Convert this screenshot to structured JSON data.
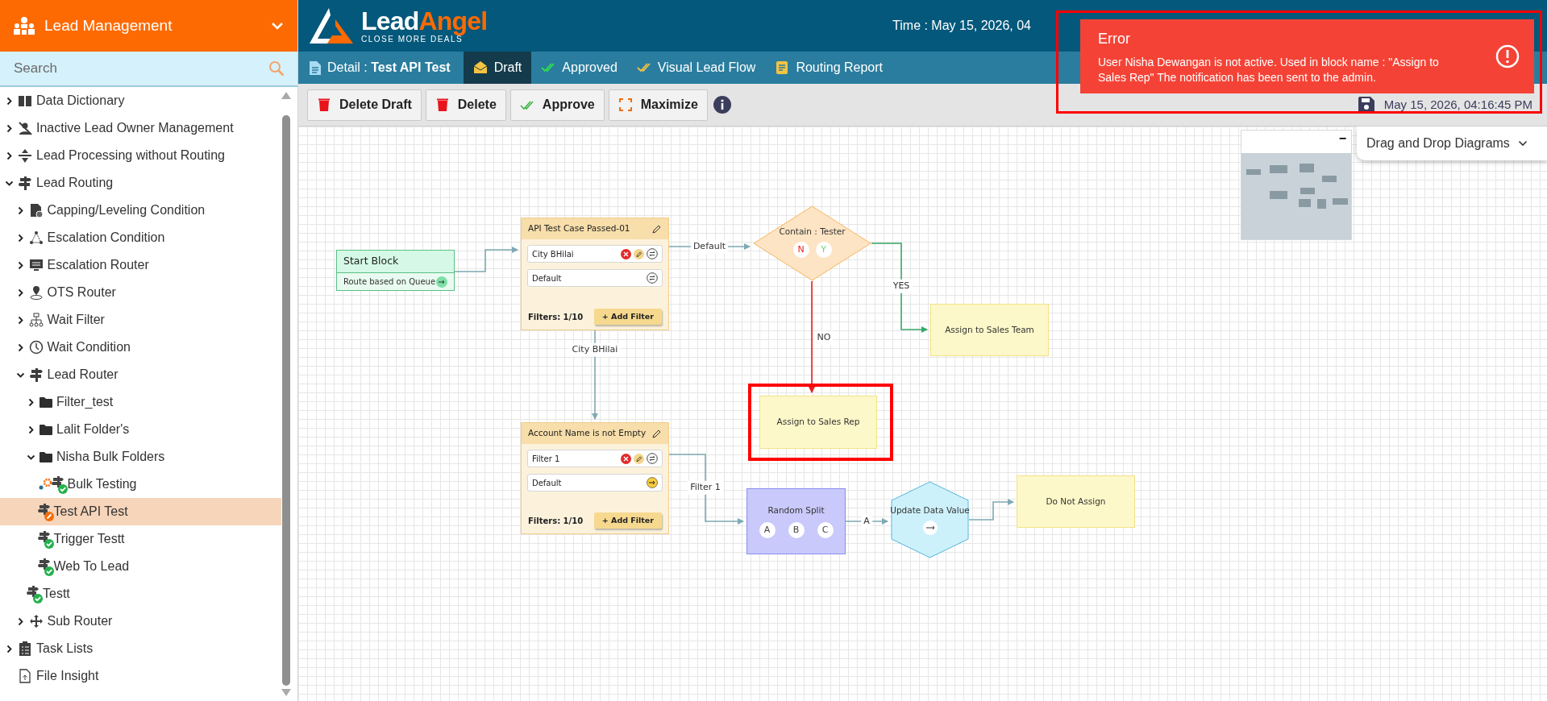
{
  "app_menu": {
    "title": "Lead Management"
  },
  "search": {
    "placeholder": "Search"
  },
  "tree": [
    {
      "label": "Data Dictionary",
      "kind": "module",
      "expanded": false,
      "selected": false
    },
    {
      "label": "Inactive Lead Owner Management",
      "kind": "module",
      "expanded": false,
      "selected": false
    },
    {
      "label": "Lead Processing without Routing",
      "kind": "module",
      "expanded": false,
      "selected": false
    },
    {
      "label": "Lead Routing",
      "kind": "module",
      "expanded": true,
      "selected": false,
      "children": [
        {
          "label": "Capping/Leveling Condition",
          "kind": "module",
          "expanded": false,
          "selected": false
        },
        {
          "label": "Escalation Condition",
          "kind": "module",
          "expanded": false,
          "selected": false
        },
        {
          "label": "Escalation Router",
          "kind": "module",
          "expanded": false,
          "selected": false
        },
        {
          "label": "OTS Router",
          "kind": "module",
          "expanded": false,
          "selected": false
        },
        {
          "label": "Wait Filter",
          "kind": "module",
          "expanded": false,
          "selected": false
        },
        {
          "label": "Wait Condition",
          "kind": "module",
          "expanded": false,
          "selected": false
        },
        {
          "label": "Lead Router",
          "kind": "module",
          "expanded": true,
          "selected": false,
          "children": [
            {
              "label": "Filter_test",
              "kind": "folder",
              "expanded": false,
              "selected": false
            },
            {
              "label": "Lalit Folder's",
              "kind": "folder",
              "expanded": false,
              "selected": false
            },
            {
              "label": "Nisha Bulk Folders",
              "kind": "folder",
              "expanded": true,
              "selected": false,
              "children": [
                {
                  "label": "Bulk Testing",
                  "kind": "router",
                  "draft": false,
                  "gear_badge": true,
                  "selected": false
                },
                {
                  "label": "Test API Test",
                  "kind": "router",
                  "draft": true,
                  "gear_badge": false,
                  "selected": true
                },
                {
                  "label": "Trigger Testt",
                  "kind": "router",
                  "draft": false,
                  "gear_badge": false,
                  "selected": false
                },
                {
                  "label": "Web To Lead",
                  "kind": "router",
                  "draft": false,
                  "gear_badge": false,
                  "selected": false
                }
              ]
            },
            {
              "label": "Testt",
              "kind": "router",
              "draft": false,
              "gear_badge": false,
              "selected": false
            }
          ]
        },
        {
          "label": "Sub Router",
          "kind": "module",
          "expanded": false,
          "selected": false
        }
      ]
    },
    {
      "label": "Task Lists",
      "kind": "module",
      "expanded": false,
      "selected": false
    },
    {
      "label": "File Insight",
      "kind": "module",
      "selected": false
    }
  ],
  "logo": {
    "word_1": "Lead",
    "word_2": "Angel",
    "tagline": "CLOSE MORE DEALS"
  },
  "header_time": "Time : May 15, 2026, 04",
  "detail_title": "Detail : **Test API Test**",
  "tabs": [
    {
      "label": "Draft",
      "selected": true
    },
    {
      "label": "Approved",
      "selected": false
    },
    {
      "label": "Visual Lead Flow",
      "selected": false
    },
    {
      "label": "Routing Report",
      "selected": false
    }
  ],
  "toolbar": [
    "Delete Draft",
    "Delete",
    "Approve",
    "Maximize"
  ],
  "saved_at": "May 15, 2026, 04:16:45 PM",
  "toast": {
    "title": "Error",
    "message": "User Nisha Dewangan is not active. Used in block name : \"Assign to Sales Rep\" The notification has been sent to the admin."
  },
  "minimap": {
    "collapse_label": "−"
  },
  "diagram_panel": {
    "title": "Drag and Drop Diagrams"
  },
  "diagram": {
    "nodes": [
      {
        "kind": "start",
        "title": "Start Block",
        "subtitle": "Route based on Queue"
      },
      {
        "kind": "filter_card",
        "title": "API Test Case Passed-01",
        "filters": [
          {
            "label": "City BHilai",
            "kind": "filter"
          },
          {
            "label": "Default",
            "kind": "default"
          }
        ],
        "count": "Filters: 1/10",
        "button": "+ Add Filter"
      },
      {
        "kind": "decision",
        "title": "Contain : Tester",
        "outputs": [
          "N",
          "Y"
        ]
      },
      {
        "kind": "assign",
        "title": "Assign to Sales Team"
      },
      {
        "kind": "assign",
        "title": "Assign to Sales Rep"
      },
      {
        "kind": "filter_card",
        "title": "Account Name is not Empty",
        "filters": [
          {
            "label": "Filter 1",
            "kind": "filter"
          },
          {
            "label": "Default",
            "kind": "default_out"
          }
        ],
        "count": "Filters: 1/10",
        "button": "+ Add Filter"
      },
      {
        "kind": "split",
        "title": "Random Split",
        "outputs": [
          "A",
          "B",
          "C"
        ]
      },
      {
        "kind": "update",
        "title": "Update Data Value"
      },
      {
        "kind": "assign",
        "title": "Do Not Assign"
      }
    ],
    "edges": [
      {
        "color": "#7fa9b3"
      },
      {
        "label": "Default",
        "color": "#7fa9b3"
      },
      {
        "label": "City BHilai",
        "color": "#7fa9b3"
      },
      {
        "label": "YES",
        "color": "#3aa86b"
      },
      {
        "label": "NO",
        "color": "#ee1c1c"
      },
      {
        "label": "Filter 1",
        "color": "#7fa9b3"
      },
      {
        "label": "A",
        "color": "#7fa9b3"
      },
      {
        "color": "#7fa9b3"
      }
    ]
  }
}
